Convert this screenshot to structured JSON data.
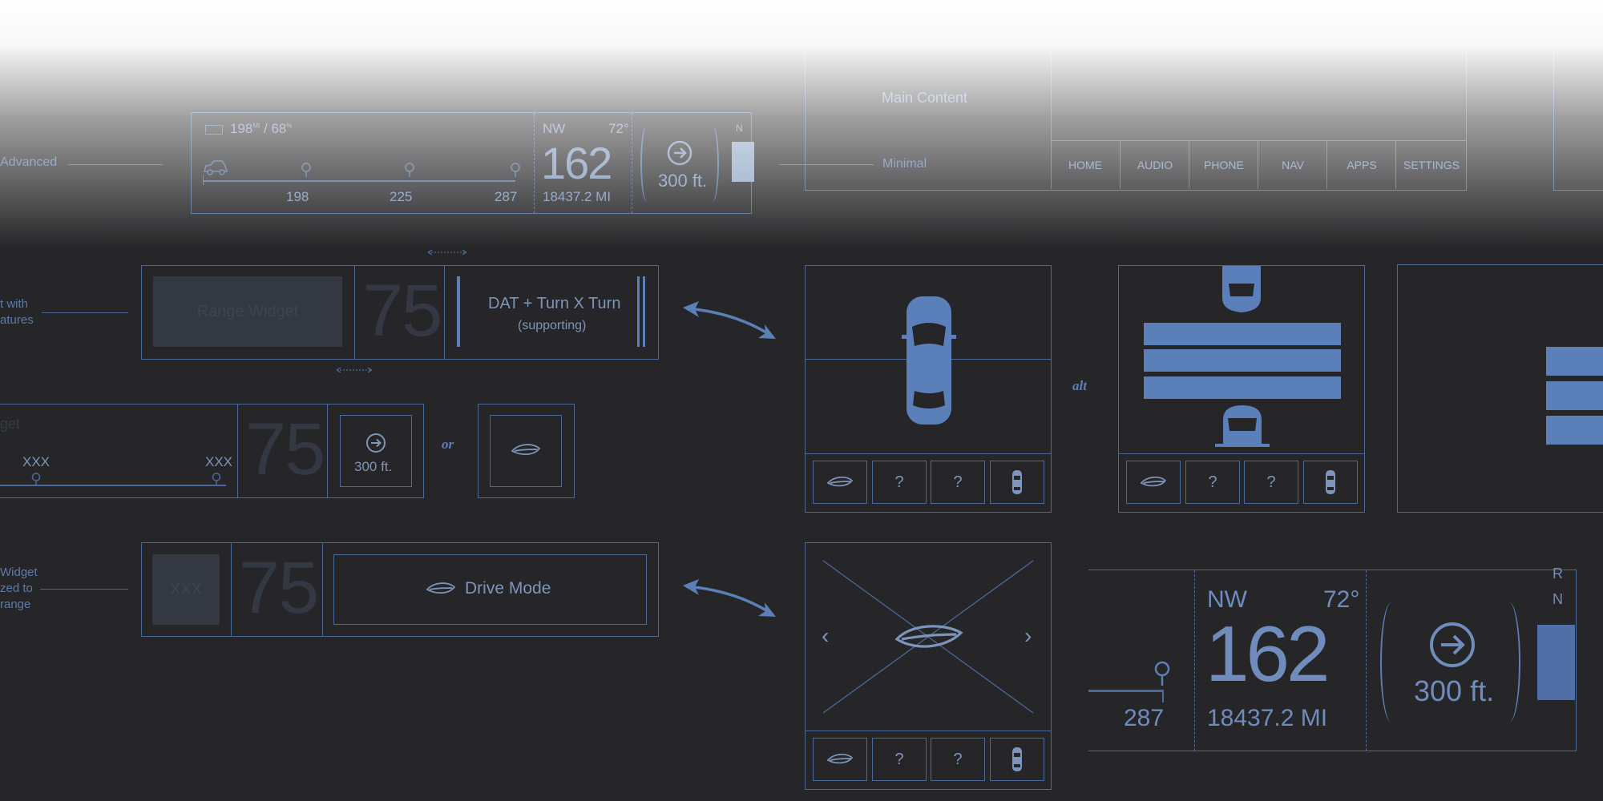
{
  "colors": {
    "background": "#262628",
    "line": "#4b6a99",
    "accent": "#5b7fb8",
    "placeholder": "#343840"
  },
  "top": {
    "advanced_label": "Advanced",
    "minimal_label": "Minimal",
    "faded_top_label": "Range Widget",
    "battery": "198",
    "battery_unit": "MI",
    "charge": "68",
    "charge_unit": "%",
    "range_ticks": [
      "198",
      "225",
      "287"
    ],
    "heading": "NW",
    "temp": "72°",
    "speed": "162",
    "odometer": "18437.2 MI",
    "turn_distance": "300 ft.",
    "gear": "N",
    "main_content": "Main Content",
    "nav_items": [
      "HOME",
      "AUDIO",
      "PHONE",
      "NAV",
      "APPS",
      "SETTINGS"
    ]
  },
  "row1": {
    "side_label_1": "t with",
    "side_label_2": "atures",
    "range_widget": "Range Widget",
    "speed": "75",
    "title": "DAT + Turn X Turn",
    "subtitle": "(supporting)"
  },
  "row2": {
    "faded_label": "get",
    "tick_left": "XXX",
    "tick_right": "XXX",
    "speed": "75",
    "turn_distance": "300 ft.",
    "or_label": "or"
  },
  "row3": {
    "side_label_1": "Widget",
    "side_label_2": "zed to",
    "side_label_3": "range",
    "placeholder": "XXX",
    "speed": "75",
    "drive_mode": "Drive Mode"
  },
  "alt_label": "alt",
  "slots": [
    "leaf-icon",
    "?",
    "?",
    "car-icon"
  ],
  "cluster": {
    "gear_r": "R",
    "gear_n": "N",
    "range_end": "287",
    "heading": "NW",
    "temp": "72°",
    "speed": "162",
    "odometer": "18437.2 MI",
    "turn_distance": "300 ft."
  }
}
